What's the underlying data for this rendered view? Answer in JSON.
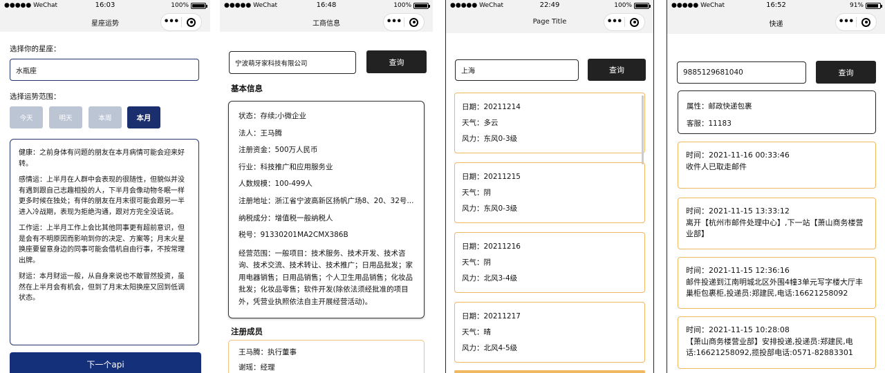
{
  "p1": {
    "status": {
      "carrier": "●●●●● WeChat",
      "time": "16:03",
      "battery": "100%"
    },
    "title": "星座运势",
    "select_sign_label": "选择你的星座：",
    "sign_value": "水瓶座",
    "select_range_label": "选择运势范围：",
    "ranges": [
      "今天",
      "明天",
      "本周",
      "本月"
    ],
    "active_range": "本月",
    "fortune": [
      "健康：之前身体有问题的朋友在本月病情可能会迎来好转。",
      "感情运：上半月在人群中会表现的很随性，但貌似并没有遇到跟自己志趣相投的人，下半月会像动物冬眠一样更多时候在独处；有伴的朋友在月末很可能会跟另一半进入冷战期，表现为拒绝沟通，跟对方完全没话说。",
      "工作运：上半月工作上会比其他同事更有超前意识，但是会有不明原因而影响到你的决定、方案等；月末火星换座要留意身边的同事可能会借机自由行事，不按常理出牌。",
      "财运：本月财运一般，从自身来说也不敢冒然投资，虽然在上半月会有机会，但到了月末太阳换座又回到低调状态。"
    ],
    "next_button": "下一个api"
  },
  "p2": {
    "status": {
      "carrier": "●●●●● WeChat",
      "time": "16:48",
      "battery": "100%"
    },
    "title": "工商信息",
    "search_value": "宁波萌牙家科技有限公司",
    "query_button": "查询",
    "basic_info_title": "基本信息",
    "info": [
      "状态：存续;小微企业",
      "法人：王马腾",
      "注册资金：500万人民币",
      "行业：科技推广和应用服务业",
      "人数规模：100-499人",
      "注册地址：浙江省宁波高新区扬帆广场8、20、32号...",
      "纳税成分：增值税一般纳税人",
      "税号：91330201MA2CMX386B"
    ],
    "scope": "经营范围：一般项目：技术服务、技术开发、技术咨询、技术交流、技术转让、技术推广；日用品批发；家用电器销售；日用品销售；个人卫生用品销售；化妆品批发；化妆品零售；软件开发(除依法须经批准的项目外，凭营业执照依法自主开展经营活动)。",
    "members_title": "注册成员",
    "members": [
      "王马腾：执行董事",
      "谢瑶：经理"
    ]
  },
  "p3": {
    "status": {
      "carrier": "●●●●● WeChat",
      "time": "22:49",
      "battery": "100%"
    },
    "title": "Page Title",
    "search_value": "上海",
    "query_button": "查询",
    "days": [
      {
        "date": "日期：20211214",
        "weather": "天气：多云",
        "wind": "风力：东风0-3级"
      },
      {
        "date": "日期：20211215",
        "weather": "天气：阴",
        "wind": "风力：东风0-3级"
      },
      {
        "date": "日期：20211216",
        "weather": "天气：阴",
        "wind": "风力：北风3-4级"
      },
      {
        "date": "日期：20211217",
        "weather": "天气：晴",
        "wind": "风力：北风4-5级"
      }
    ]
  },
  "p4": {
    "status": {
      "carrier": "●●●●● WeChat",
      "time": "16:52",
      "battery": "91%"
    },
    "title": "快递",
    "search_value": "9885129681040",
    "query_button": "查询",
    "attribute": "属性：邮政快递包裹",
    "service": "客服：11183",
    "tracks": [
      {
        "time": "时间：2021-11-16 00:33:46",
        "desc": "收件人已取走邮件"
      },
      {
        "time": "时间：2021-11-15 13:33:12",
        "desc": "离开【杭州市邮件处理中心】,下一站【萧山商务楼营业部】"
      },
      {
        "time": "时间：2021-11-15 12:36:16",
        "desc": "邮件投递到江南明城北区外围4幢3单元写字楼大厅丰巢柜包裹柜,投递员:郑建民,电话:16621258092"
      },
      {
        "time": "时间：2021-11-15 10:28:08",
        "desc": "【萧山商务楼营业部】安排投递,投递员:郑建民,电话:16621258092,揽投部电话:0571-82883301"
      }
    ]
  }
}
